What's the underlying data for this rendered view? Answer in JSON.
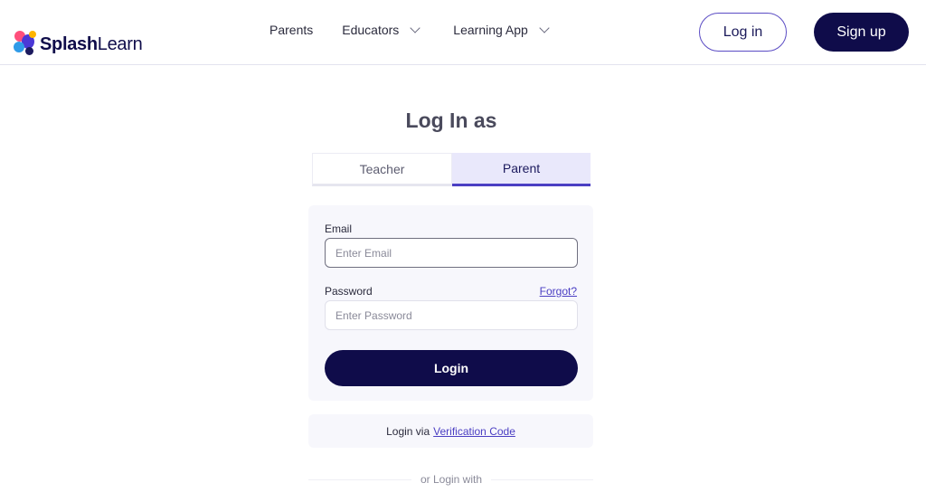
{
  "brand": {
    "name_bold": "Splash",
    "name_light": "Learn"
  },
  "nav": {
    "parents": "Parents",
    "educators": "Educators",
    "learning_app": "Learning App"
  },
  "header_actions": {
    "login": "Log in",
    "signup": "Sign up"
  },
  "login_panel": {
    "title": "Log In as",
    "tabs": [
      {
        "label": "Teacher",
        "active": false
      },
      {
        "label": "Parent",
        "active": true
      }
    ],
    "email": {
      "label": "Email",
      "placeholder": "Enter Email",
      "value": ""
    },
    "password": {
      "label": "Password",
      "placeholder": "Enter Password",
      "value": ""
    },
    "forgot": "Forgot?",
    "submit": "Login",
    "verification": {
      "prefix": "Login via",
      "link": "Verification Code"
    },
    "alt_login": "or Login with"
  },
  "colors": {
    "brand_navy": "#0f0c4a",
    "accent_purple": "#4b3fc3",
    "tab_active_bg": "#e9e8fb",
    "card_bg": "#f7f7fc"
  }
}
